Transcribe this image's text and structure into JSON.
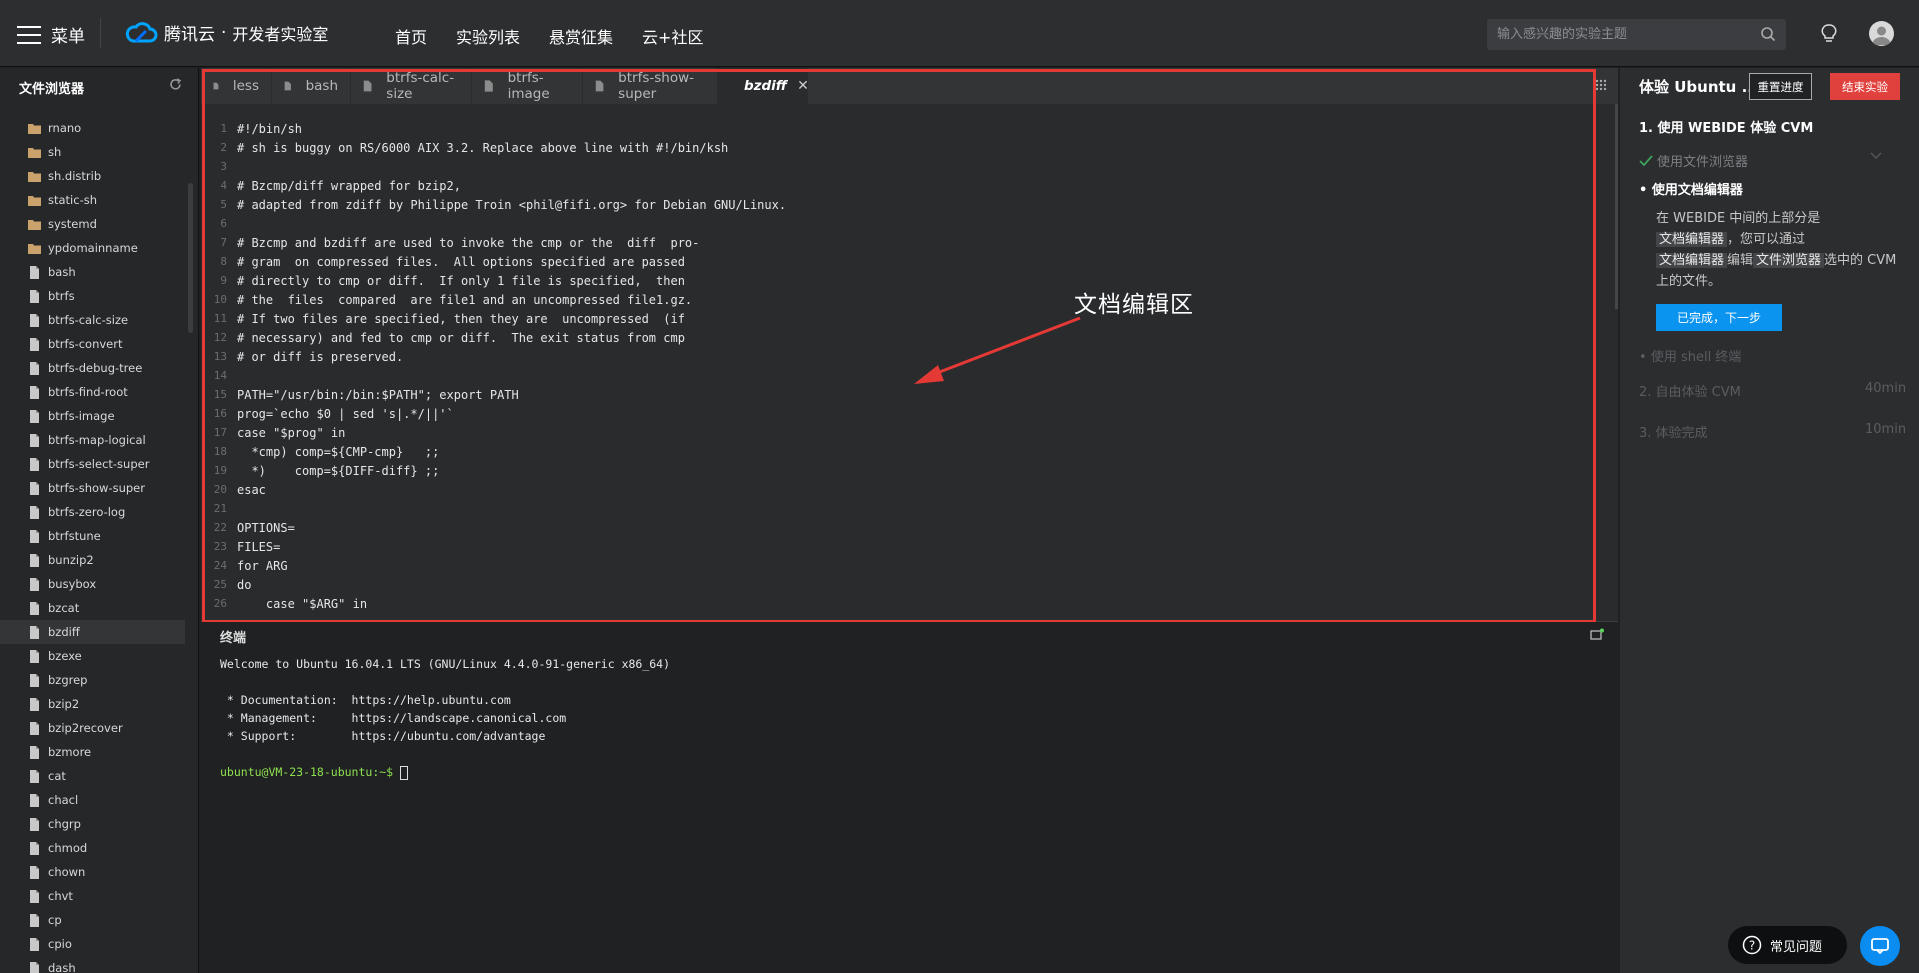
{
  "topbar": {
    "menu_label": "菜单",
    "brand": "腾讯云",
    "brand_dot": "·",
    "brand_sub": "开发者实验室",
    "nav": [
      "首页",
      "实验列表",
      "悬赏征集",
      "云+社区"
    ],
    "search_placeholder": "输入感兴趣的实验主题"
  },
  "sidebar": {
    "title": "文件浏览器",
    "items": [
      {
        "label": "rnano",
        "type": "folder"
      },
      {
        "label": "sh",
        "type": "folder"
      },
      {
        "label": "sh.distrib",
        "type": "folder"
      },
      {
        "label": "static-sh",
        "type": "folder"
      },
      {
        "label": "systemd",
        "type": "folder"
      },
      {
        "label": "ypdomainname",
        "type": "folder"
      },
      {
        "label": "bash",
        "type": "file"
      },
      {
        "label": "btrfs",
        "type": "file"
      },
      {
        "label": "btrfs-calc-size",
        "type": "file"
      },
      {
        "label": "btrfs-convert",
        "type": "file"
      },
      {
        "label": "btrfs-debug-tree",
        "type": "file"
      },
      {
        "label": "btrfs-find-root",
        "type": "file"
      },
      {
        "label": "btrfs-image",
        "type": "file"
      },
      {
        "label": "btrfs-map-logical",
        "type": "file"
      },
      {
        "label": "btrfs-select-super",
        "type": "file"
      },
      {
        "label": "btrfs-show-super",
        "type": "file"
      },
      {
        "label": "btrfs-zero-log",
        "type": "file"
      },
      {
        "label": "btrfstune",
        "type": "file"
      },
      {
        "label": "bunzip2",
        "type": "file"
      },
      {
        "label": "busybox",
        "type": "file"
      },
      {
        "label": "bzcat",
        "type": "file"
      },
      {
        "label": "bzdiff",
        "type": "file",
        "selected": true
      },
      {
        "label": "bzexe",
        "type": "file"
      },
      {
        "label": "bzgrep",
        "type": "file"
      },
      {
        "label": "bzip2",
        "type": "file"
      },
      {
        "label": "bzip2recover",
        "type": "file"
      },
      {
        "label": "bzmore",
        "type": "file"
      },
      {
        "label": "cat",
        "type": "file"
      },
      {
        "label": "chacl",
        "type": "file"
      },
      {
        "label": "chgrp",
        "type": "file"
      },
      {
        "label": "chmod",
        "type": "file"
      },
      {
        "label": "chown",
        "type": "file"
      },
      {
        "label": "chvt",
        "type": "file"
      },
      {
        "label": "cp",
        "type": "file"
      },
      {
        "label": "cpio",
        "type": "file"
      },
      {
        "label": "dash",
        "type": "file"
      }
    ]
  },
  "editor": {
    "tabs": [
      {
        "label": "less",
        "active": false
      },
      {
        "label": "bash",
        "active": false
      },
      {
        "label": "btrfs-calc-size",
        "active": false
      },
      {
        "label": "btrfs-image",
        "active": false
      },
      {
        "label": "btrfs-show-super",
        "active": false
      },
      {
        "label": "bzdiff",
        "active": true
      }
    ],
    "lines": [
      "#!/bin/sh",
      "# sh is buggy on RS/6000 AIX 3.2. Replace above line with #!/bin/ksh",
      "",
      "# Bzcmp/diff wrapped for bzip2,",
      "# adapted from zdiff by Philippe Troin <phil@fifi.org> for Debian GNU/Linux.",
      "",
      "# Bzcmp and bzdiff are used to invoke the cmp or the  diff  pro-",
      "# gram  on compressed files.  All options specified are passed",
      "# directly to cmp or diff.  If only 1 file is specified,  then",
      "# the  files  compared  are file1 and an uncompressed file1.gz.",
      "# If two files are specified, then they are  uncompressed  (if",
      "# necessary) and fed to cmp or diff.  The exit status from cmp",
      "# or diff is preserved.",
      "",
      "PATH=\"/usr/bin:/bin:$PATH\"; export PATH",
      "prog=`echo $0 | sed 's|.*/||'`",
      "case \"$prog\" in",
      "  *cmp) comp=${CMP-cmp}   ;;",
      "  *)    comp=${DIFF-diff} ;;",
      "esac",
      "",
      "OPTIONS=",
      "FILES=",
      "for ARG",
      "do",
      "    case \"$ARG\" in"
    ]
  },
  "annotation": {
    "label": "文档编辑区",
    "color": "#e53935"
  },
  "terminal": {
    "title": "终端",
    "lines": [
      "Welcome to Ubuntu 16.04.1 LTS (GNU/Linux 4.4.0-91-generic x86_64)",
      "",
      " * Documentation:  https://help.ubuntu.com",
      " * Management:     https://landscape.canonical.com",
      " * Support:        https://ubuntu.com/advantage",
      ""
    ],
    "prompt": "ubuntu@VM-23-18-ubuntu:~$ "
  },
  "rpanel": {
    "title": "体验 Ubuntu ...",
    "reset": "重置进度",
    "end": "结束实验",
    "step1": "1. 使用 WEBIDE 体验 CVM",
    "sub_done": "使用文件浏览器",
    "sub_active": "使用文档编辑器",
    "desc_1": "在 WEBIDE 中间的上部分是",
    "desc_chip1": "文档编辑器",
    "desc_2": "，您可以通过",
    "desc_chip2": "文档编辑器",
    "desc_3": "编辑",
    "desc_chip3": "文件浏览器",
    "desc_4": "选中的 CVM 上的文件。",
    "next": "已完成，下一步",
    "sub_next": "使用 shell 终端",
    "step2": "2. 自由体验 CVM",
    "step2_time": "40min",
    "step3": "3. 体验完成",
    "step3_time": "10min"
  },
  "float": {
    "faq": "常见问题"
  },
  "colors": {
    "accent": "#0a94f0",
    "danger": "#e0413d",
    "prompt": "#8ee04f"
  }
}
